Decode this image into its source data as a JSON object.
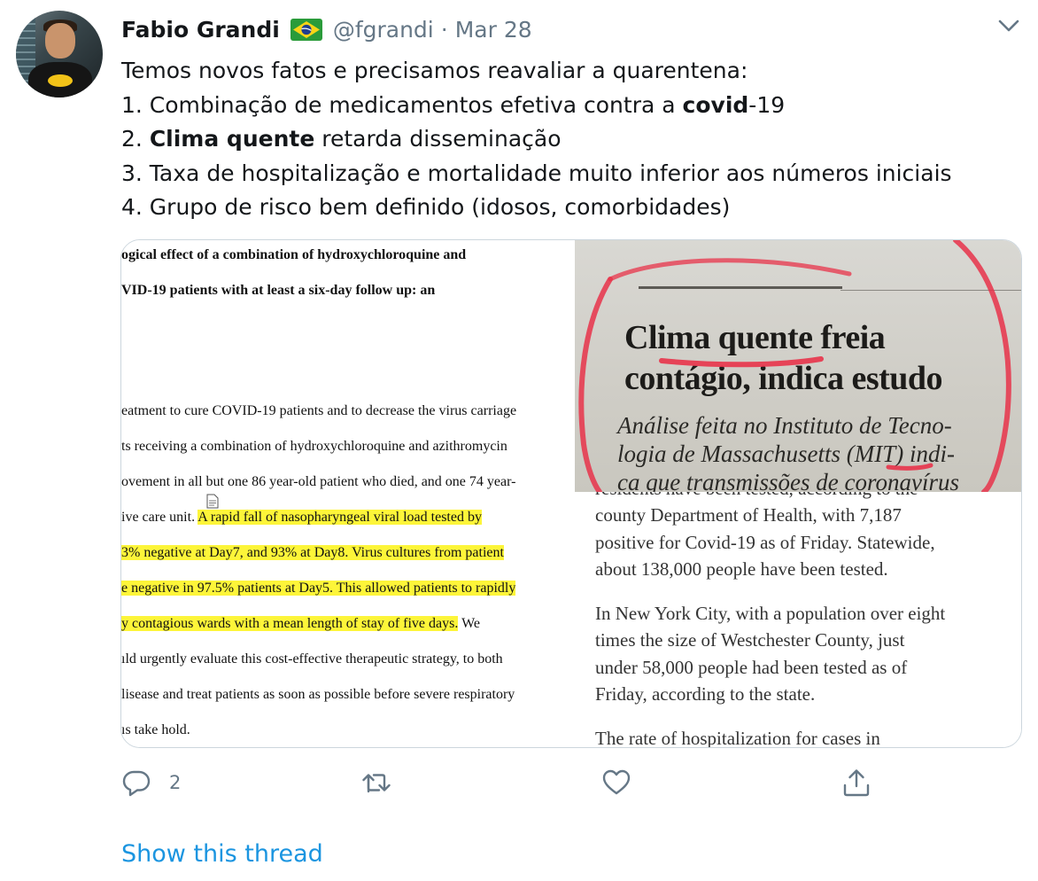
{
  "author": {
    "name": "Fabio Grandi",
    "flag_icon": "brazil-flag-icon",
    "handle": "@fgrandi",
    "separator": "·",
    "date": "Mar 28"
  },
  "tweet": {
    "line1": "Temos novos fatos e precisamos reavaliar a quarentena:",
    "line2_prefix": "1. Combinação de medicamentos efetiva contra a ",
    "line2_bold": "covid",
    "line2_suffix": "-19",
    "line3_prefix": "2. ",
    "line3_bold": "Clima quente",
    "line3_suffix": " retarda disseminação",
    "line4": "3. Taxa de hospitalização e mortalidade muito inferior aos números iniciais",
    "line5": "4. Grupo de risco bem definido (idosos, comorbidades)"
  },
  "media": {
    "left_document": {
      "title_line1": "ogical effect of a combination of hydroxychloroquine and",
      "title_line2": "VID-19 patients with at least a six-day follow up: an",
      "body_line1": "eatment to cure COVID-19 patients and to decrease the virus carriage",
      "body_line2": "ts receiving a combination of hydroxychloroquine and azithromycin",
      "body_line3": "ovement in all but one 86 year-old patient who died, and one 74 year-",
      "body_line4_plain": "ive care unit. ",
      "body_line4_hl": "A rapid fall of nasopharyngeal viral load tested by",
      "body_line5_hl": "3% negative at Day7, and 93% at Day8. Virus cultures from patient",
      "body_line6_hl": "e negative in 97.5% patients at Day5. This allowed patients to rapidly",
      "body_line7_hl": "y contagious wards with a mean length of stay of five days.",
      "body_line7_plain": " We",
      "body_line8": "ıld urgently evaluate this cost-effective therapeutic strategy, to both",
      "body_line9": "lisease and treat patients as soon as possible before severe respiratory",
      "body_line10": "ıs take hold.",
      "highlight_color": "#fdf539"
    },
    "newspaper_clipping": {
      "headline_line1": "Clima quente freia",
      "headline_line2": "contágio, indica estudo",
      "sub_line1": "Análise feita no Instituto de Tecno-",
      "sub_line2": "logia de Massachusetts (MIT) indi-",
      "sub_line3": "ca que transmissões de coronavírus",
      "marker_color": "#e8334a"
    },
    "news_article": {
      "line1": "residents have been tested, according to the",
      "line2": "county Department of Health, with 7,187",
      "line3": "positive for Covid-19 as of Friday. Statewide,",
      "line4": "about 138,000 people have been tested.",
      "line5": "In New York City, with a population over eight",
      "line6": "times the size of Westchester County, just",
      "line7": "under 58,000 people had been tested as of",
      "line8": "Friday, according to the state.",
      "line9": "The rate of hospitalization for cases in"
    }
  },
  "actions": {
    "reply_icon": "reply-icon",
    "reply_count": "2",
    "retweet_icon": "retweet-icon",
    "like_icon": "heart-icon",
    "share_icon": "share-icon"
  },
  "show_thread": "Show this thread",
  "colors": {
    "text": "#14171a",
    "secondary": "#657786",
    "link": "#1b95e0",
    "border": "#ccd6dd"
  }
}
